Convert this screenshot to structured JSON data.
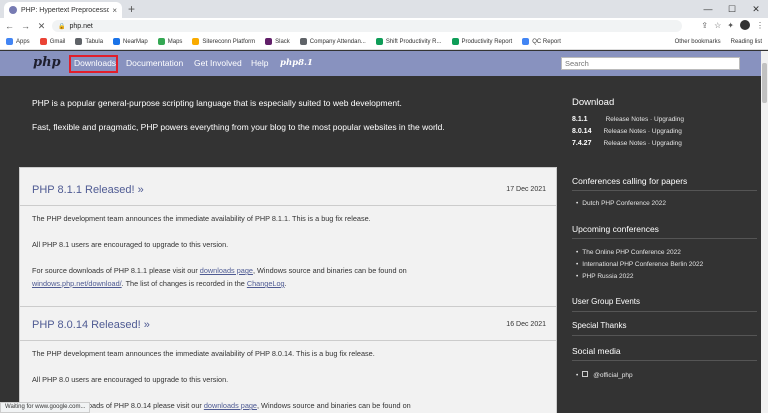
{
  "browser": {
    "tab_title": "PHP: Hypertext Preprocessor",
    "tab_close": "×",
    "new_tab": "+",
    "url": "php.net",
    "bookmarks": [
      {
        "label": "Apps",
        "color": "#4285f4"
      },
      {
        "label": "Gmail",
        "color": "#ea4335"
      },
      {
        "label": "Tabula",
        "color": "#5f6368"
      },
      {
        "label": "NearMap",
        "color": "#1a73e8"
      },
      {
        "label": "Maps",
        "color": "#34a853"
      },
      {
        "label": "Sitereconn Platform",
        "color": "#f9ab00"
      },
      {
        "label": "Slack",
        "color": "#611f69"
      },
      {
        "label": "Company Attendan...",
        "color": "#5f6368"
      },
      {
        "label": "Shift Productivity R...",
        "color": "#0f9d58"
      },
      {
        "label": "Productivity Report",
        "color": "#0f9d58"
      },
      {
        "label": "QC Report",
        "color": "#4285f4"
      }
    ],
    "other_bookmarks": "Other bookmarks",
    "reading_list": "Reading list",
    "status": "Waiting for www.google.com..."
  },
  "php_nav": {
    "logo": "php",
    "items": [
      "Downloads",
      "Documentation",
      "Get Involved",
      "Help"
    ],
    "php8_logo": "php8.1",
    "search_placeholder": "Search"
  },
  "intro": {
    "line1": "PHP is a popular general-purpose scripting language that is especially suited to web development.",
    "line2": "Fast, flexible and pragmatic, PHP powers everything from your blog to the most popular websites in the world."
  },
  "sidebar": {
    "download_title": "Download",
    "releases": [
      {
        "version": "8.1.1",
        "links": "Release Notes · Upgrading"
      },
      {
        "version": "8.0.14",
        "links": "Release Notes · Upgrading"
      },
      {
        "version": "7.4.27",
        "links": "Release Notes · Upgrading"
      }
    ],
    "conf_papers_title": "Conferences calling for papers",
    "conf_papers": [
      "Dutch PHP Conference 2022"
    ],
    "upcoming_title": "Upcoming conferences",
    "upcoming": [
      "The Online PHP Conference 2022",
      "International PHP Conference Berlin 2022",
      "PHP Russia 2022"
    ],
    "user_groups": "User Group Events",
    "special_thanks": "Special Thanks",
    "social_title": "Social media",
    "social_handle": "@official_php"
  },
  "news": [
    {
      "title": "PHP 8.1.1 Released! »",
      "date": "17 Dec 2021",
      "p1": "The PHP development team announces the immediate availability of PHP 8.1.1. This is a bug fix release.",
      "p2": "All PHP 8.1 users are encouraged to upgrade to this version.",
      "p3a": "For source downloads of PHP 8.1.1 please visit our ",
      "p3link": "downloads page",
      "p3b": ", Windows source and binaries can be found on",
      "p3link2": "windows.php.net/download/",
      "p3c": ". The list of changes is recorded in the ",
      "p3link3": "ChangeLog",
      "p3d": "."
    },
    {
      "title": "PHP 8.0.14 Released! »",
      "date": "16 Dec 2021",
      "p1": "The PHP development team announces the immediate availability of PHP 8.0.14. This is a bug fix release.",
      "p2": "All PHP 8.0 users are encouraged to upgrade to this version.",
      "p3a": "For source downloads of PHP 8.0.14 please visit our ",
      "p3link": "downloads page",
      "p3b": ", Windows source and binaries can be found on"
    }
  ]
}
